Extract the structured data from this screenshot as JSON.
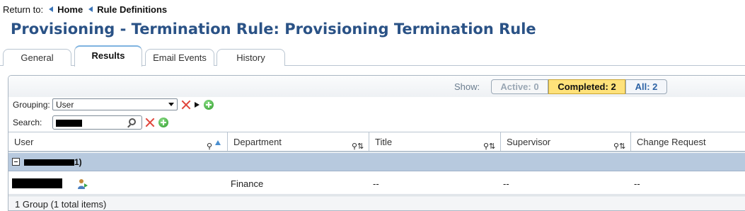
{
  "breadcrumb": {
    "prefix": "Return to:",
    "items": [
      "Home",
      "Rule Definitions"
    ]
  },
  "page_title": "Provisioning - Termination Rule: Provisioning Termination Rule",
  "tabs": [
    {
      "label": "General",
      "active": false
    },
    {
      "label": "Results",
      "active": true
    },
    {
      "label": "Email Events",
      "active": false
    },
    {
      "label": "History",
      "active": false
    }
  ],
  "filters": {
    "show_label": "Show:",
    "active": "Active: 0",
    "completed": "Completed: 2",
    "all": "All: 2",
    "selected": "completed"
  },
  "grouping": {
    "label": "Grouping:",
    "value": "User"
  },
  "search": {
    "label": "Search:",
    "value": "[redacted]"
  },
  "columns": [
    "User",
    "Department",
    "Title",
    "Supervisor",
    "Change Request"
  ],
  "group": {
    "label_suffix": "1)",
    "collapsed": false
  },
  "rows": [
    {
      "user": "[redacted]",
      "department": "Finance",
      "title": "--",
      "supervisor": "--",
      "change_request": "--"
    }
  ],
  "footer": "1 Group (1 total items)",
  "colors": {
    "title": "#2a5286",
    "group_row": "#b7c9de",
    "completed_highlight": "#ffe27a",
    "delete_icon": "#e0443a",
    "add_icon": "#2d9a2a"
  }
}
